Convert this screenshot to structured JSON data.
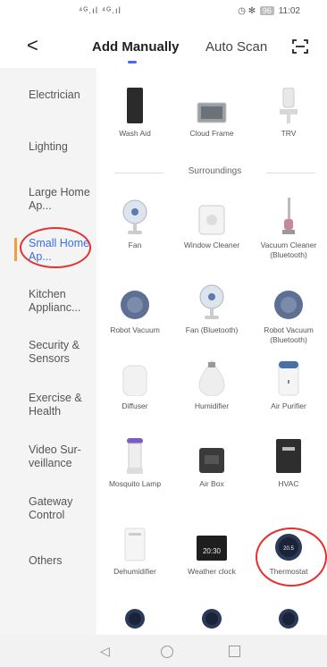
{
  "status_bar": {
    "signal": "⁴ᴳ.ıl ⁴ᴳ.ıl ",
    "time": "11:02",
    "battery": "96"
  },
  "header": {
    "back_label": "<",
    "tabs": [
      "Add Manually",
      "Auto Scan"
    ]
  },
  "sidebar": {
    "items": [
      {
        "label": "Electrician"
      },
      {
        "label": "Lighting"
      },
      {
        "label": "Large Home Ap..."
      },
      {
        "label": "Small Home Ap..."
      },
      {
        "label": "Kitchen Applianc..."
      },
      {
        "label": "Security & Sensors"
      },
      {
        "label": "Exercise & Health"
      },
      {
        "label": "Video Sur-veillance"
      },
      {
        "label": "Gateway Control"
      },
      {
        "label": "Others"
      }
    ]
  },
  "main": {
    "top_items": [
      {
        "label": "Wash Aid"
      },
      {
        "label": "Cloud Frame"
      },
      {
        "label": "TRV"
      }
    ],
    "section_title": "Surroundings",
    "items": [
      {
        "label": "Fan"
      },
      {
        "label": "Window Cleaner"
      },
      {
        "label": "Vacuum Cleaner (Bluetooth)"
      },
      {
        "label": "Robot Vacuum"
      },
      {
        "label": "Fan (Bluetooth)"
      },
      {
        "label": "Robot Vacuum (Bluetooth)"
      },
      {
        "label": "Diffuser"
      },
      {
        "label": "Humidifier"
      },
      {
        "label": "Air Purifier"
      },
      {
        "label": "Mosquito Lamp"
      },
      {
        "label": "Air Box"
      },
      {
        "label": "HVAC"
      },
      {
        "label": "Dehumidifier"
      },
      {
        "label": "Weather clock"
      },
      {
        "label": "Thermostat"
      }
    ],
    "device_readouts": {
      "weather_clock": "20:30",
      "thermostat": "20.5"
    }
  }
}
